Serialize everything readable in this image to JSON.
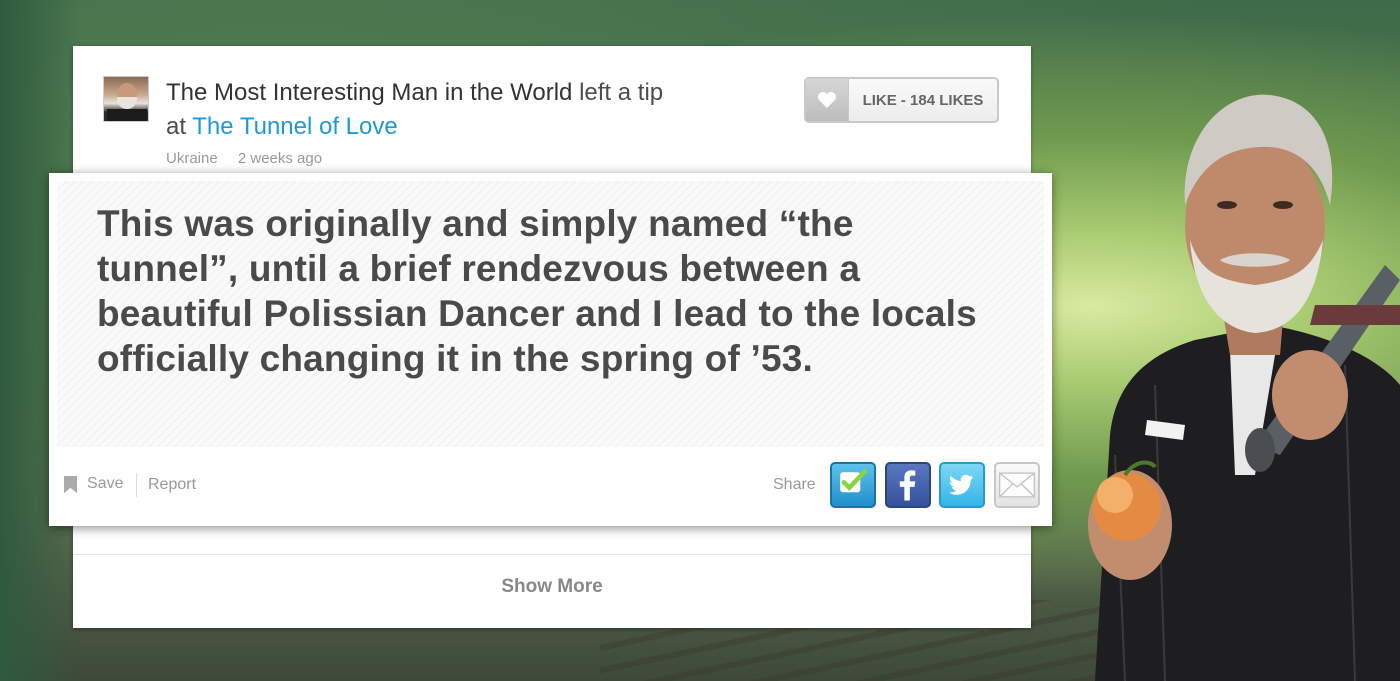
{
  "tip": {
    "user_name": "The Most Interesting Man in the World",
    "action_text": "left a tip",
    "at_text": "at",
    "venue_name": "The Tunnel of Love",
    "location": "Ukraine",
    "time_ago": "2 weeks ago",
    "like_label": "LIKE - 184 LIKES",
    "text": "This was originally and simply named “the tunnel”, until a brief rendezvous between a beautiful Polissian Dancer and I lead to the locals officially changing it in the spring of ’53."
  },
  "actions": {
    "save_label": "Save",
    "report_label": "Report",
    "share_label": "Share",
    "share_targets": [
      "foursquare-icon",
      "facebook-icon",
      "twitter-icon",
      "email-icon"
    ]
  },
  "background_list": {
    "ghost_location": "Ukraine",
    "show_more_label": "Show More"
  },
  "colors": {
    "link": "#1d9ad6",
    "ghost_chip": "#64bc2a",
    "facebook": "#3b5998",
    "twitter": "#33b4e6",
    "foursquare": "#1f8fca"
  }
}
